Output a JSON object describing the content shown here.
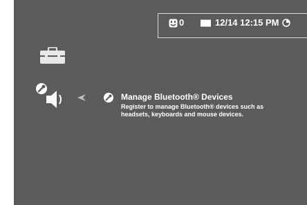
{
  "status_bar": {
    "friends_count": "0",
    "datetime": "12/14 12:15 PM"
  },
  "icons": {
    "friends": "smiley-face-icon",
    "messages": "message-card-icon",
    "clock": "clock-icon",
    "category": "toolbox-icon",
    "current_setting": "wrench-sound-icon",
    "back": "back-arrow-icon",
    "option": "wrench-icon"
  },
  "settings_menu": {
    "selected_option": {
      "title": "Manage Bluetooth® Devices",
      "description": "Register to manage Bluetooth® devices such as headsets, keyboards and mouse devices."
    }
  },
  "colors": {
    "background": "#5b5b5b",
    "text": "#ffffff",
    "panel_border": "#d8d8d8"
  }
}
